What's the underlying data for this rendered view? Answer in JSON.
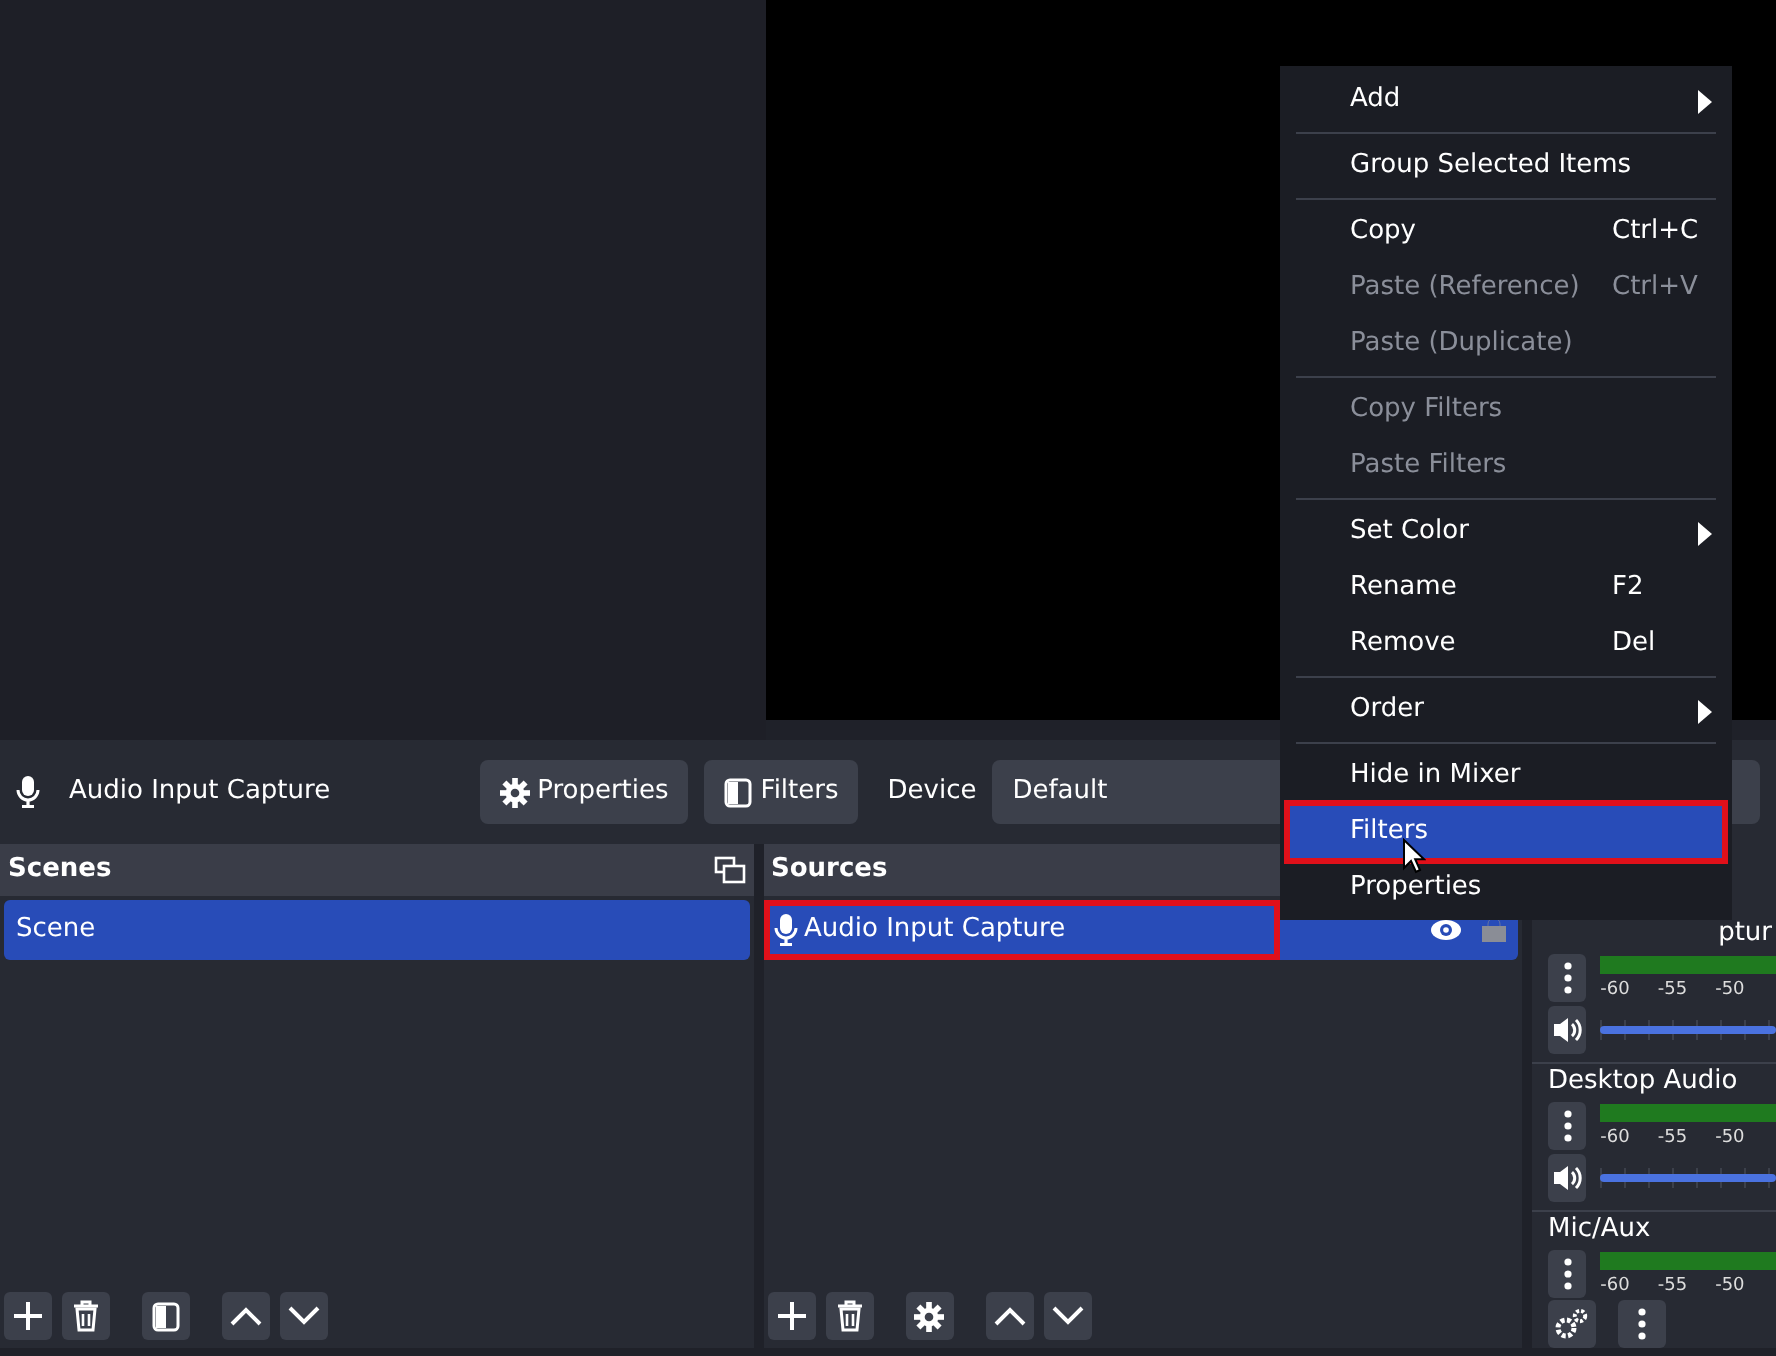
{
  "toolbar": {
    "source_name": "Audio Input Capture",
    "buttons": [
      {
        "kind": "properties",
        "label": "Properties"
      },
      {
        "kind": "filters",
        "label": "Filters"
      }
    ],
    "device_label": "Device",
    "device_value": "Default"
  },
  "scenes": {
    "title": "Scenes",
    "items": [
      {
        "label": "Scene",
        "selected": true
      }
    ]
  },
  "sources": {
    "title": "Sources",
    "items": [
      {
        "label": "Audio Input Capture",
        "selected": true,
        "highlighted": true,
        "visible": true,
        "locked": false
      }
    ]
  },
  "mixer": {
    "channels": [
      {
        "kind": "full",
        "name": "ptur",
        "scale": [
          "-60",
          "-55",
          "-50"
        ],
        "level": 1
      },
      {
        "kind": "full",
        "name": "Desktop Audio",
        "scale": [
          "-60",
          "-55",
          "-50"
        ],
        "level": 1
      },
      {
        "kind": "meter_only",
        "name": "Mic/Aux",
        "scale": [
          "-60",
          "-55",
          "-50"
        ]
      }
    ]
  },
  "context_menu": {
    "items": [
      {
        "kind": "item",
        "label": "Add",
        "submenu": true,
        "disabled": false,
        "selected": false
      },
      {
        "kind": "separator"
      },
      {
        "kind": "item",
        "label": "Group Selected Items",
        "disabled": false,
        "selected": false
      },
      {
        "kind": "separator"
      },
      {
        "kind": "item",
        "label": "Copy",
        "shortcut": "Ctrl+C",
        "disabled": false,
        "selected": false
      },
      {
        "kind": "item",
        "label": "Paste (Reference)",
        "shortcut": "Ctrl+V",
        "disabled": true,
        "selected": false
      },
      {
        "kind": "item",
        "label": "Paste (Duplicate)",
        "disabled": true,
        "selected": false
      },
      {
        "kind": "separator"
      },
      {
        "kind": "item",
        "label": "Copy Filters",
        "disabled": true,
        "selected": false
      },
      {
        "kind": "item",
        "label": "Paste Filters",
        "disabled": true,
        "selected": false
      },
      {
        "kind": "separator"
      },
      {
        "kind": "item",
        "label": "Set Color",
        "submenu": true,
        "disabled": false,
        "selected": false
      },
      {
        "kind": "item",
        "label": "Rename",
        "shortcut": "F2",
        "disabled": false,
        "selected": false
      },
      {
        "kind": "item",
        "label": "Remove",
        "shortcut": "Del",
        "disabled": false,
        "selected": false
      },
      {
        "kind": "separator"
      },
      {
        "kind": "item",
        "label": "Order",
        "submenu": true,
        "disabled": false,
        "selected": false
      },
      {
        "kind": "separator"
      },
      {
        "kind": "item",
        "label": "Hide in Mixer",
        "disabled": false,
        "selected": false
      },
      {
        "kind": "item",
        "label": "Filters",
        "disabled": false,
        "selected": true,
        "highlighted": true
      },
      {
        "kind": "item",
        "label": "Properties",
        "disabled": false,
        "selected": false
      }
    ]
  }
}
